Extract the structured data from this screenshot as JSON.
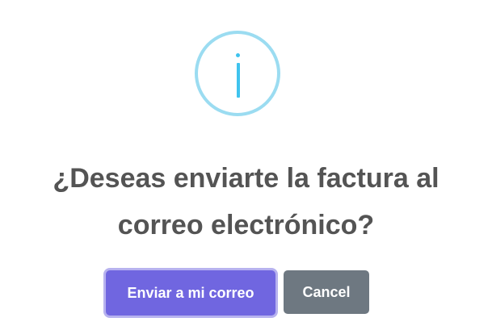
{
  "dialog": {
    "icon": "info-icon",
    "title": "¿Deseas enviarte la factura al correo electrónico?",
    "confirm_label": "Enviar a mi correo",
    "cancel_label": "Cancel"
  },
  "colors": {
    "icon_ring": "#9bdcf1",
    "icon_glyph": "#3fc3ee",
    "title_text": "#545454",
    "confirm_button": "#7066e0",
    "cancel_button": "#6e7881",
    "button_text": "#ffffff",
    "background": "#ffffff"
  }
}
